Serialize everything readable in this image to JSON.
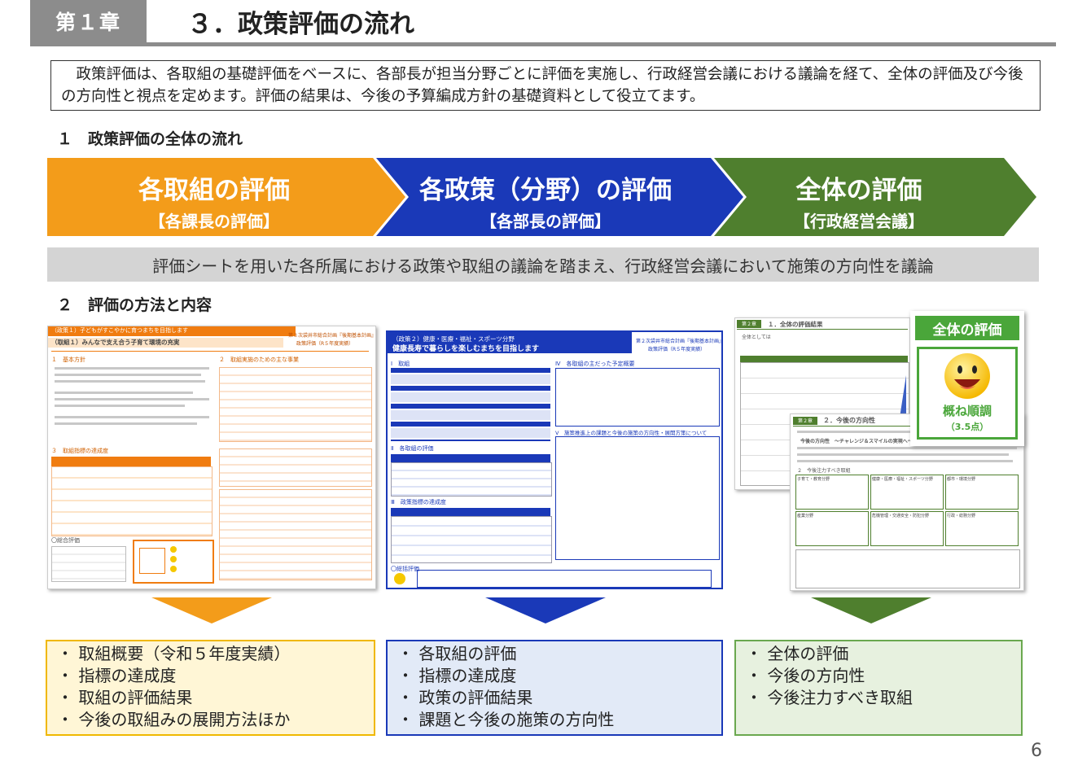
{
  "header": {
    "chapter": "第１章",
    "title": "３．政策評価の流れ"
  },
  "intro": "政策評価は、各取組の基礎評価をベースに、各部長が担当分野ごとに評価を実施し、行政経営会議における議論を経て、全体の評価及び今後の方向性と視点を定めます。評価の結果は、今後の予算編成方針の基礎資料として役立てます。",
  "section1": "１　政策評価の全体の流れ",
  "flow": [
    {
      "title": "各取組の評価",
      "sub": "【各課長の評価】",
      "color": "#f39c1a"
    },
    {
      "title": "各政策（分野）の評価",
      "sub": "【各部長の評価】",
      "color": "#1a39b8"
    },
    {
      "title": "全体の評価",
      "sub": "【行政経営会議】",
      "color": "#4f7f2e"
    }
  ],
  "summary": "評価シートを用いた各所属における政策や取組の議論を踏まえ、行政経営会議において施策の方向性を議論",
  "section2": "２　評価の方法と内容",
  "sheets": {
    "left": {
      "banner": "（政策１）子どもがすこやかに育つまちを目指します",
      "subtitle": "（取組１）みんなで支え合う子育て環境の充実",
      "plan_label": "第３次袋井市総合計画『後期基本計画』",
      "plan_sub": "政策評価（R５年度実績）",
      "sec1": "１　基本方針",
      "sec2": "２　取組実施のための主な事業",
      "sec3": "３　取組指標の達成度",
      "eval": "〇総合評価"
    },
    "middle": {
      "banner": "（政策２）健康・医療・福祉・スポーツ分野",
      "title": "健康長寿で暮らしを楽しむまちを目指します",
      "plan_label": "第２次袋井市総合計画『後期基本計画』",
      "plan_sub": "政策評価（R５年度実績）",
      "sec1": "Ⅰ　取組",
      "sec2": "Ⅳ　各取組の主だった予定概要",
      "sec3": "Ⅱ　各取組の評価",
      "sec4": "Ⅲ　政策指標の達成度",
      "sec5": "Ⅴ　施策推進上の課題と今後の施策の方向性・展開方策について",
      "eval": "〇総括評価"
    },
    "right": {
      "sec1": "１．全体の評価結果",
      "sec2": "２．今後の方向性",
      "badge1": "第２章",
      "badge2": "第２章",
      "sub_label": "全体としては",
      "direction": "今後の方向性　～チャレンジ＆スマイルの実現へ～",
      "focus": "２　今後注力すべき取組",
      "cells": [
        "健康・医療・福祉・スポーツ分野",
        "都市・環境分野",
        "産業分野",
        "危機管理・交通安全・防犯分野",
        "子育て・教育分野",
        "行政・総務分野"
      ]
    },
    "overall": {
      "label": "全体の評価",
      "verdict": "概ね順調",
      "score": "（3.5点）"
    }
  },
  "bullets": {
    "left": [
      "取組概要（令和５年度実績）",
      "指標の達成度",
      "取組の評価結果",
      "今後の取組みの展開方法ほか"
    ],
    "middle": [
      "各取組の評価",
      "指標の達成度",
      "政策の評価結果",
      "課題と今後の施策の方向性"
    ],
    "right": [
      "全体の評価",
      "今後の方向性",
      "今後注力すべき取組"
    ]
  },
  "page_number": "6"
}
